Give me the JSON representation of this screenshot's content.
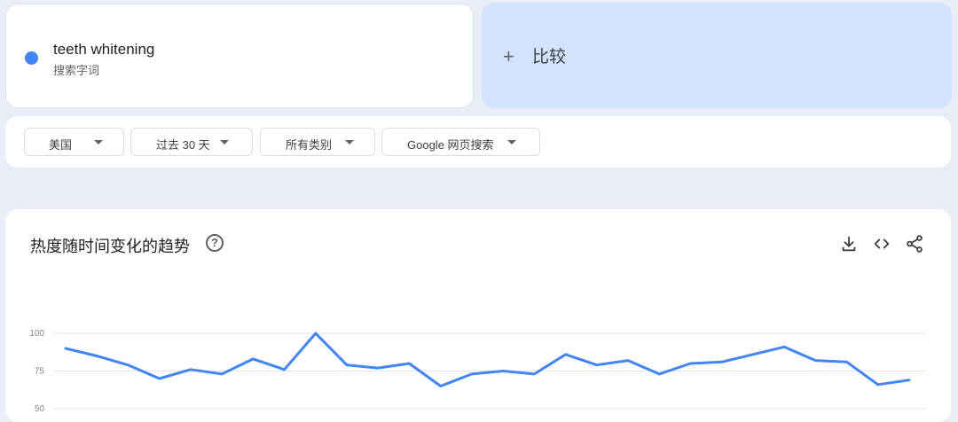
{
  "search_term": {
    "name": "teeth whitening",
    "type_label": "搜索字词",
    "color": "#4285f4"
  },
  "compare": {
    "plus": "+",
    "label": "比较"
  },
  "filters": {
    "region": "美国",
    "time_range": "过去 30 天",
    "category": "所有类别",
    "search_type": "Google 网页搜索"
  },
  "chart_section": {
    "title": "热度随时间变化的趋势",
    "help": "?"
  },
  "icons": {
    "help": "help-circle-icon",
    "download": "download-icon",
    "embed": "code-icon",
    "share": "share-icon"
  },
  "chart_data": {
    "type": "line",
    "series": [
      {
        "color": "#4285f4",
        "values": [
          90,
          85,
          79,
          70,
          76,
          73,
          83,
          76,
          100,
          79,
          77,
          80,
          65,
          73,
          75,
          73,
          86,
          79,
          82,
          73,
          80,
          81,
          86,
          91,
          82,
          81,
          66,
          69
        ]
      }
    ],
    "y_ticks": [
      "100",
      "75",
      "50"
    ],
    "y_tick_values": [
      100,
      75,
      50
    ],
    "ylim": [
      50,
      100
    ],
    "grid": true
  }
}
